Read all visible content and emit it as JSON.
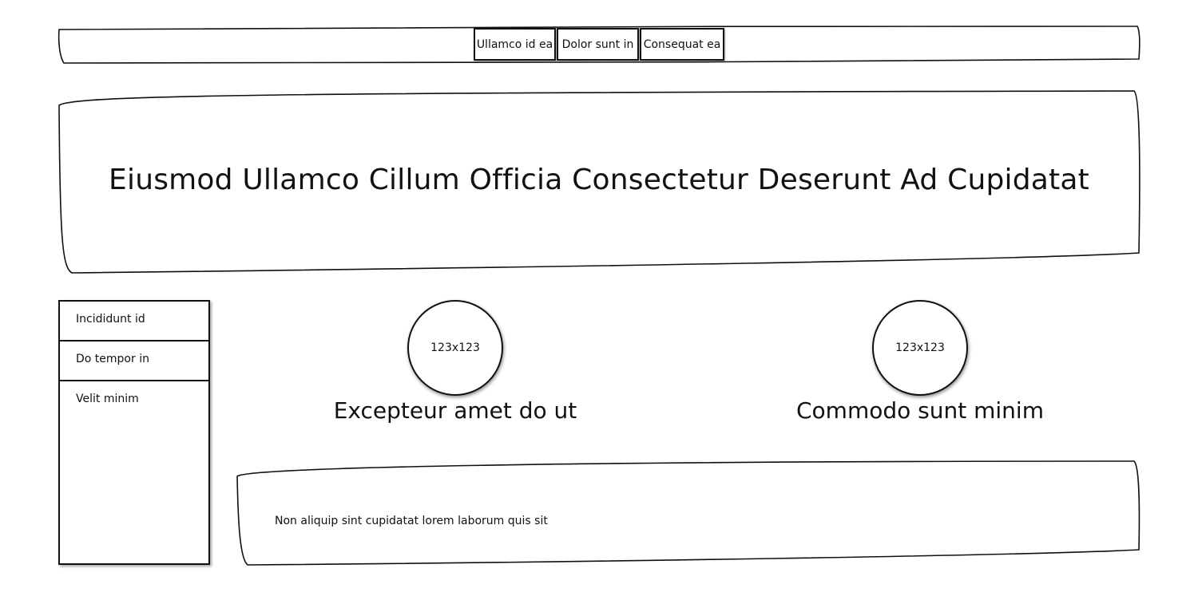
{
  "nav": {
    "tabs": [
      {
        "label": "Ullamco id ea"
      },
      {
        "label": "Dolor sunt in"
      },
      {
        "label": "Consequat ea"
      }
    ]
  },
  "hero": {
    "title": "Eiusmod Ullamco Cillum Officia Consectetur Deserunt Ad Cupidatat"
  },
  "sidebar": {
    "items": [
      {
        "label": "Incididunt id"
      },
      {
        "label": "Do tempor in"
      },
      {
        "label": "Velit minim"
      }
    ]
  },
  "cards": [
    {
      "image_label": "123x123",
      "title": "Excepteur amet do ut"
    },
    {
      "image_label": "123x123",
      "title": "Commodo sunt minim"
    }
  ],
  "footer_panel": {
    "text": "Non aliquip sint cupidatat lorem laborum quis sit"
  }
}
